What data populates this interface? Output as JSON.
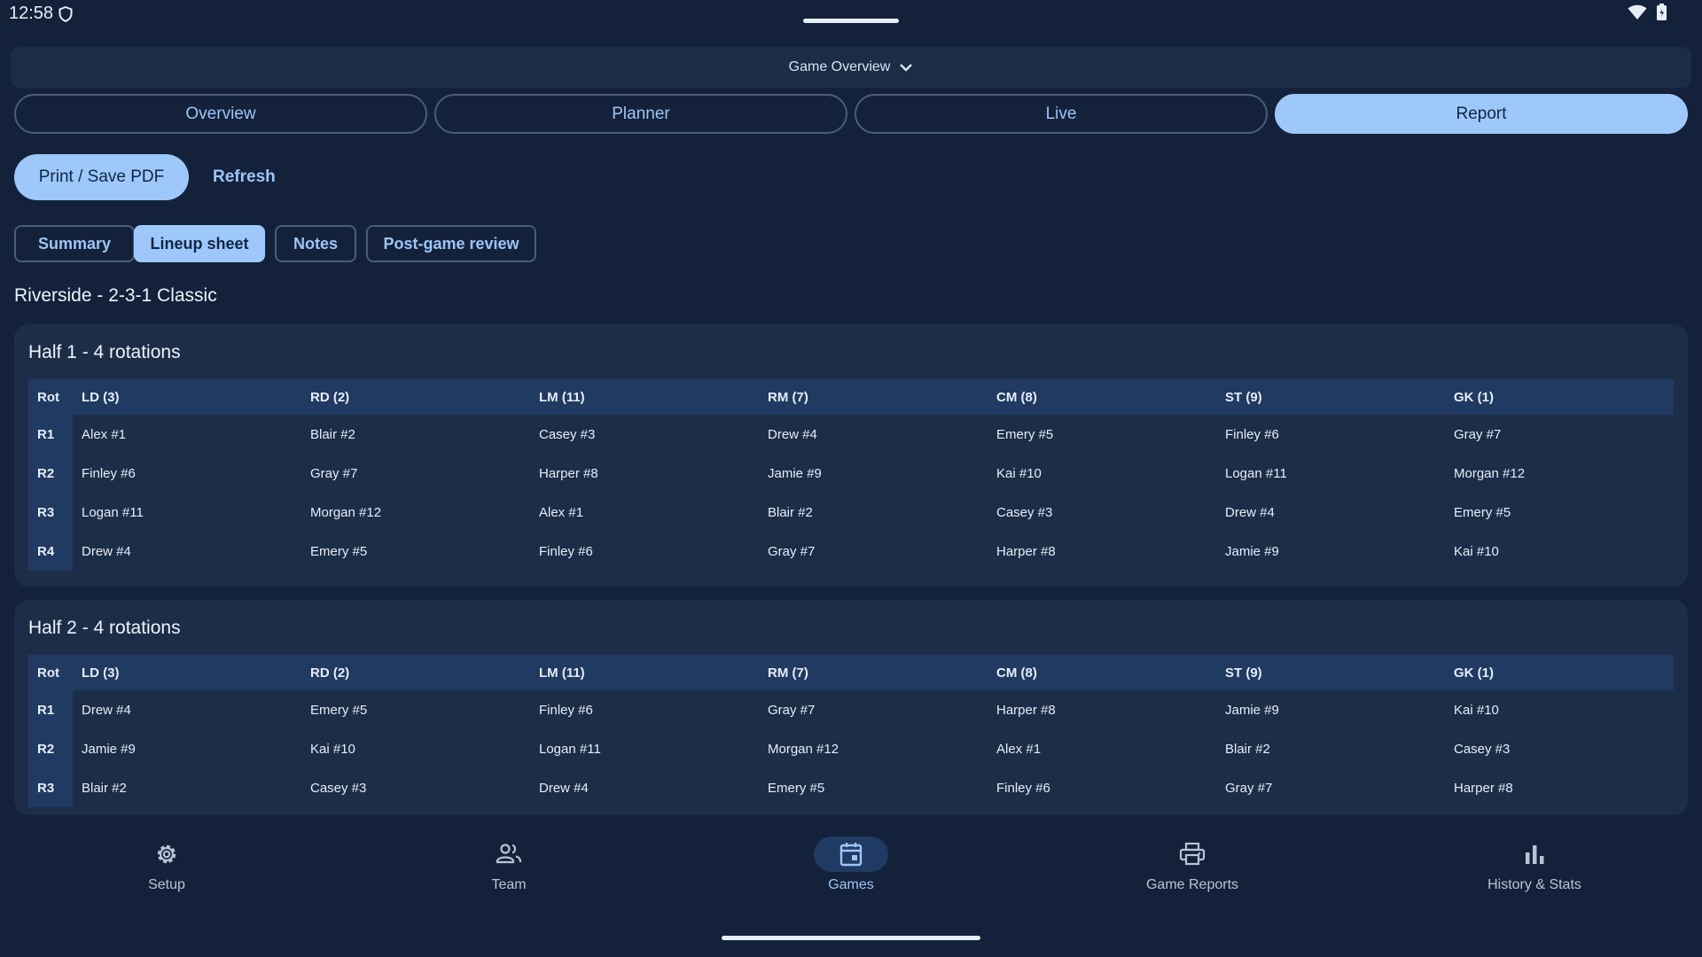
{
  "status_bar": {
    "time": "12:58"
  },
  "header": {
    "title": "Game Overview"
  },
  "tabs": [
    {
      "label": "Overview"
    },
    {
      "label": "Planner"
    },
    {
      "label": "Live"
    },
    {
      "label": "Report"
    }
  ],
  "actions": {
    "print_label": "Print / Save PDF",
    "refresh_label": "Refresh"
  },
  "chips": [
    {
      "label": "Summary"
    },
    {
      "label": "Lineup sheet"
    },
    {
      "label": "Notes"
    },
    {
      "label": "Post-game review"
    }
  ],
  "formation_title": "Riverside - 2-3-1 Classic",
  "columns": [
    "Rot",
    "LD (3)",
    "RD (2)",
    "LM (11)",
    "RM (7)",
    "CM (8)",
    "ST (9)",
    "GK (1)"
  ],
  "halves": [
    {
      "title": "Half 1 - 4 rotations",
      "rows": [
        [
          "R1",
          "Alex #1",
          "Blair #2",
          "Casey #3",
          "Drew #4",
          "Emery #5",
          "Finley #6",
          "Gray #7"
        ],
        [
          "R2",
          "Finley #6",
          "Gray #7",
          "Harper #8",
          "Jamie #9",
          "Kai #10",
          "Logan #11",
          "Morgan #12"
        ],
        [
          "R3",
          "Logan #11",
          "Morgan #12",
          "Alex #1",
          "Blair #2",
          "Casey #3",
          "Drew #4",
          "Emery #5"
        ],
        [
          "R4",
          "Drew #4",
          "Emery #5",
          "Finley #6",
          "Gray #7",
          "Harper #8",
          "Jamie #9",
          "Kai #10"
        ]
      ]
    },
    {
      "title": "Half 2 - 4 rotations",
      "rows": [
        [
          "R1",
          "Drew #4",
          "Emery #5",
          "Finley #6",
          "Gray #7",
          "Harper #8",
          "Jamie #9",
          "Kai #10"
        ],
        [
          "R2",
          "Jamie #9",
          "Kai #10",
          "Logan #11",
          "Morgan #12",
          "Alex #1",
          "Blair #2",
          "Casey #3"
        ],
        [
          "R3",
          "Blair #2",
          "Casey #3",
          "Drew #4",
          "Emery #5",
          "Finley #6",
          "Gray #7",
          "Harper #8"
        ]
      ]
    }
  ],
  "bottom_nav": [
    {
      "label": "Setup",
      "icon": "gear-icon"
    },
    {
      "label": "Team",
      "icon": "people-icon"
    },
    {
      "label": "Games",
      "icon": "calendar-icon"
    },
    {
      "label": "Game Reports",
      "icon": "printer-icon"
    },
    {
      "label": "History & Stats",
      "icon": "bar-chart-icon"
    }
  ],
  "colors": {
    "background": "#13223a",
    "accent": "#9ec8fa",
    "card": "#1c2d48",
    "table_header": "#203a62"
  }
}
